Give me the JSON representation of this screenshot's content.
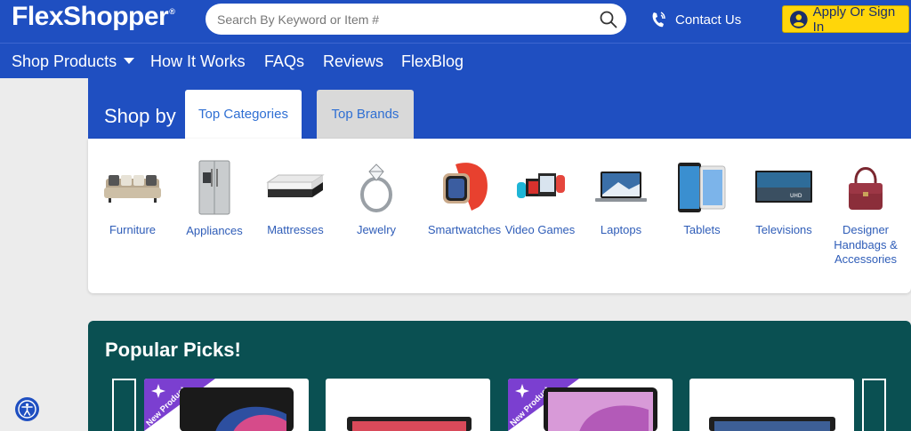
{
  "header": {
    "logo_text": "FlexShopper",
    "logo_mark": "®",
    "search_placeholder": "Search By Keyword or Item #",
    "contact_label": "Contact Us",
    "signin_label": "Apply Or Sign In"
  },
  "nav": {
    "items": [
      "Shop Products",
      "How It Works",
      "FAQs",
      "Reviews",
      "FlexBlog"
    ]
  },
  "shop_by": {
    "label": "Shop by",
    "tabs": [
      "Top Categories",
      "Top Brands"
    ],
    "categories": [
      {
        "label": "Furniture",
        "icon": "sofa-icon"
      },
      {
        "label": "Appliances",
        "icon": "refrigerator-icon"
      },
      {
        "label": "Mattresses",
        "icon": "mattress-icon"
      },
      {
        "label": "Jewelry",
        "icon": "ring-icon"
      },
      {
        "label": "Smartwatches",
        "icon": "smartwatch-icon"
      },
      {
        "label": "Video Games",
        "icon": "game-console-icon"
      },
      {
        "label": "Laptops",
        "icon": "laptop-icon"
      },
      {
        "label": "Tablets",
        "icon": "tablet-icon"
      },
      {
        "label": "Televisions",
        "icon": "tv-icon"
      },
      {
        "label": "Designer Handbags & Accessories",
        "icon": "handbag-icon"
      }
    ]
  },
  "popular": {
    "title": "Popular Picks!",
    "badge": "New Product"
  },
  "colors": {
    "brand_blue": "#1f4fc1",
    "accent_yellow": "#ffd60a",
    "popular_teal": "#0a5052",
    "badge_purple": "#7b3fd0"
  }
}
